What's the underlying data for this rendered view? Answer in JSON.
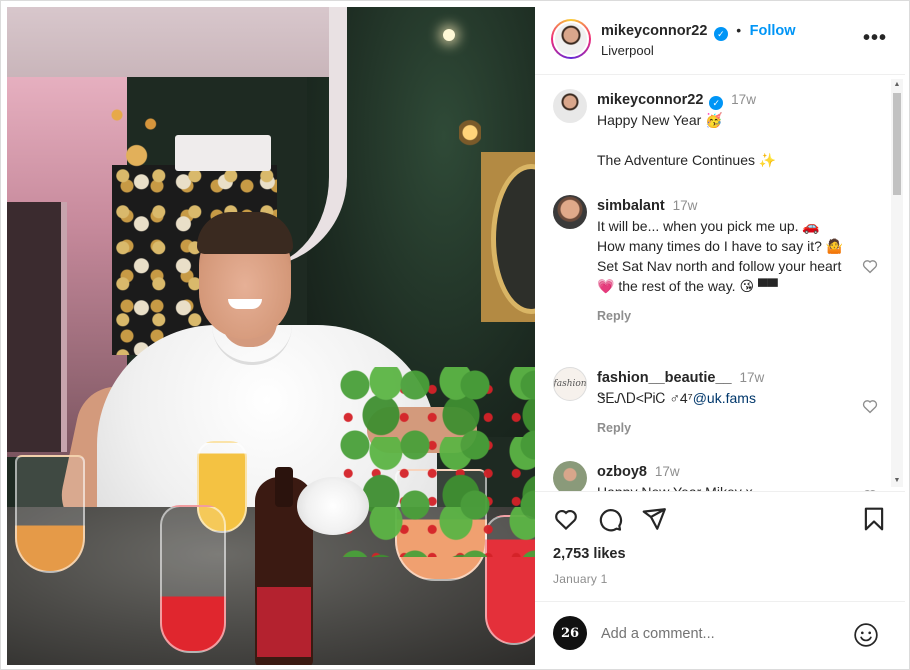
{
  "post": {
    "author": "mikeyconnor22",
    "location": "Liverpool",
    "follow_label": "Follow",
    "separator": "•",
    "more_label": "•••",
    "verified_mark": "✓"
  },
  "comments": [
    {
      "user": "mikeyconnor22",
      "verified": true,
      "time": "17w",
      "lines": [
        "Happy New Year 🥳",
        "",
        "The Adventure Continues ✨"
      ],
      "avatar": "mikey"
    },
    {
      "user": "simbalant",
      "time": "17w",
      "lines": [
        "It will be... when you pick me up. 🚗 How many times do I have to say it? 🤷 Set Sat Nav north and follow your heart 💗 the rest of the way. 😘 ▀▀"
      ],
      "reply": "Reply",
      "avatar": "simbalant"
    },
    {
      "user": "fashion__beautie__",
      "time": "17w",
      "text_plain": "ᏕᎬᏁᎠ<ᏢᎥᏟ ♂4⁷",
      "mention": "@uk.fams",
      "reply": "Reply",
      "avatar_text": "fashion"
    },
    {
      "user": "ozboy8",
      "time": "17w",
      "lines": [
        "Happy New Year Mikey x"
      ],
      "avatar": "ozboy"
    }
  ],
  "stats": {
    "likes": "2,753 likes",
    "date": "January 1"
  },
  "composer": {
    "placeholder": "Add a comment...",
    "avatar_text": "26"
  },
  "icons": {
    "like": "heart-icon",
    "comment": "comment-bubble-icon",
    "share": "paper-plane-icon",
    "save": "bookmark-icon",
    "more": "ellipsis-icon",
    "emoji": "smiley-face-icon"
  },
  "colors": {
    "accent": "#0095f6",
    "text": "#262626",
    "muted": "#8e8e8e",
    "border": "#dbdbdb"
  }
}
